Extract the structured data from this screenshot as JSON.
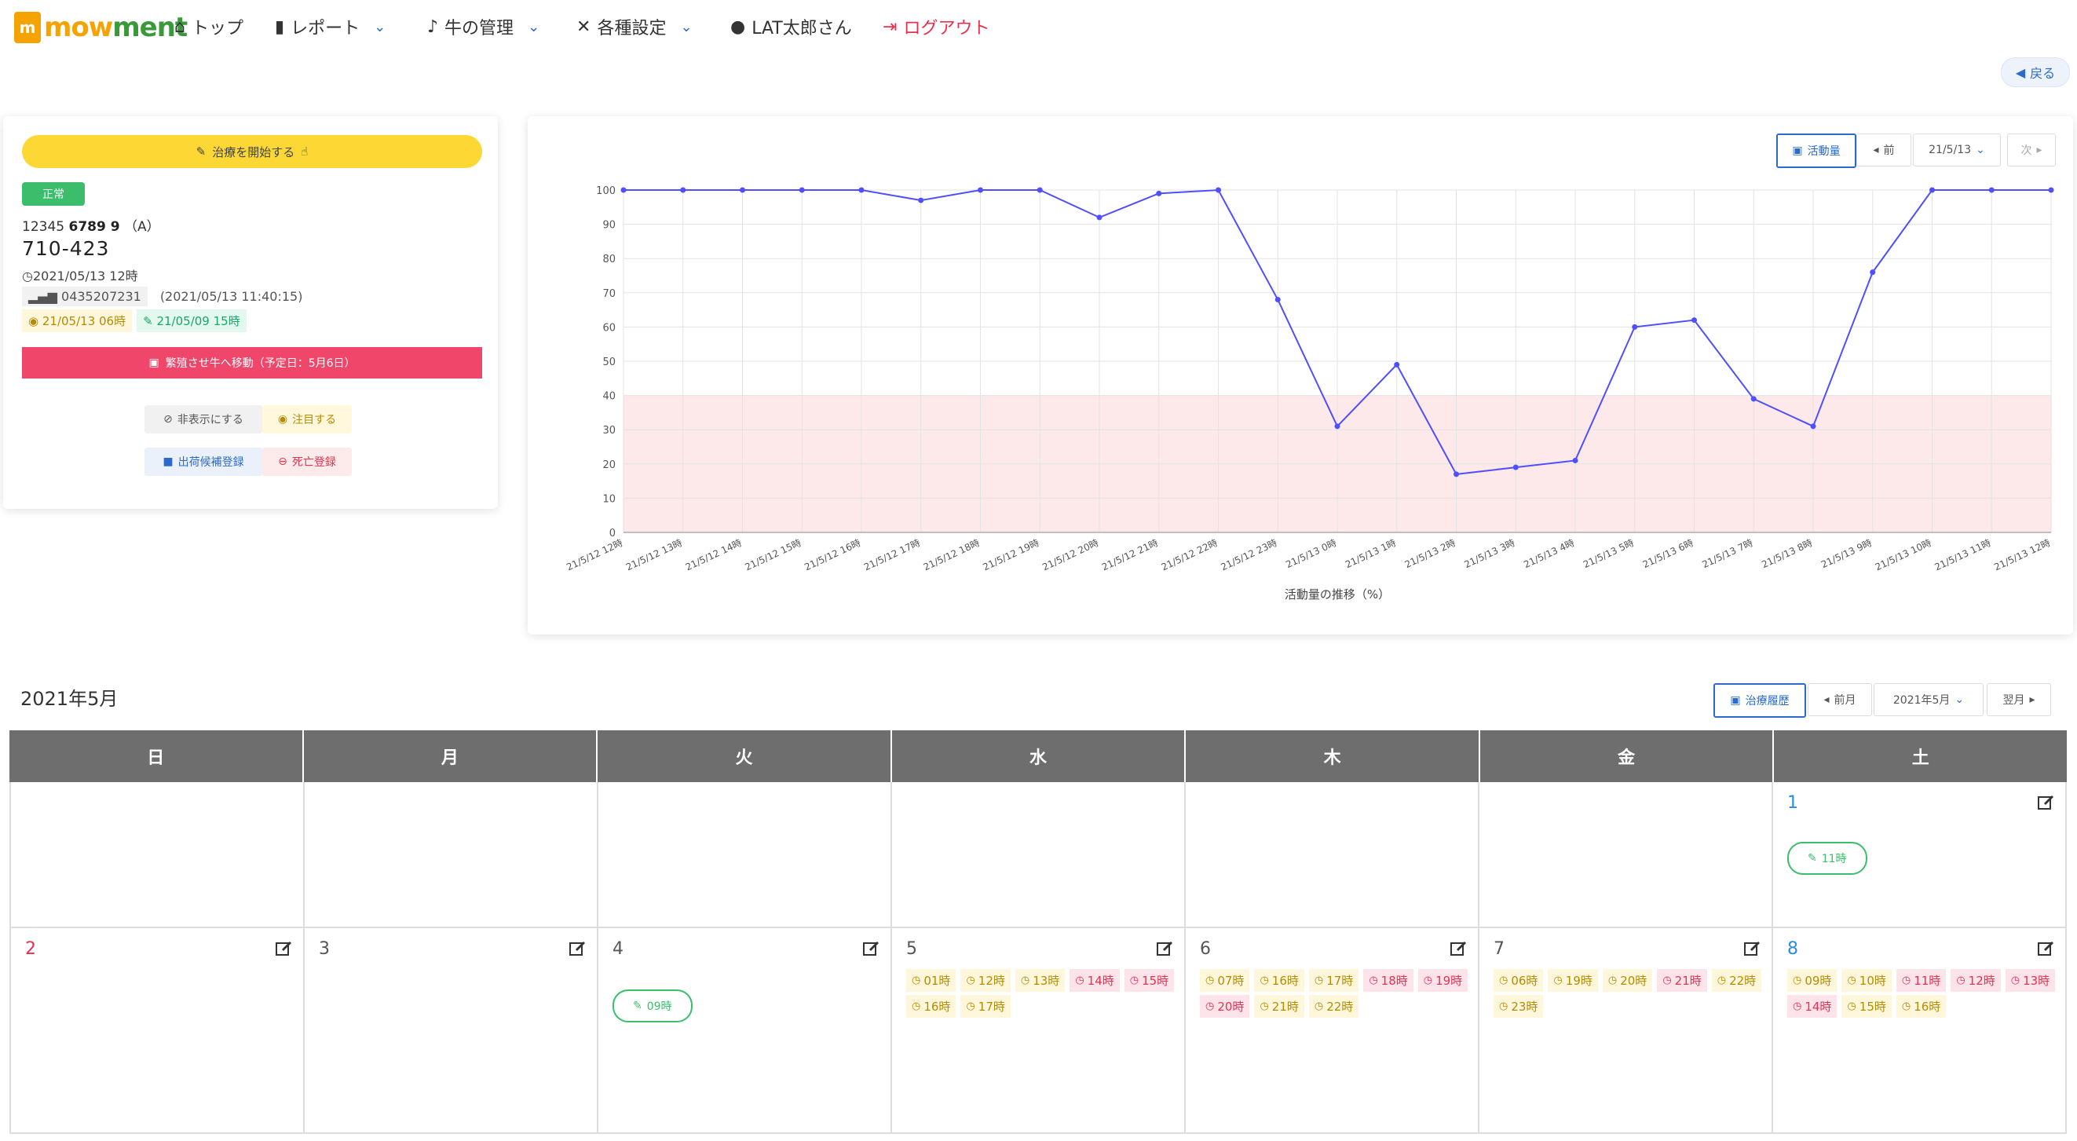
{
  "nav": {
    "logo": "mowment",
    "items": [
      "トップ",
      "レポート",
      "牛の管理",
      "各種設定",
      "LAT太郎さん",
      "ログアウト"
    ]
  },
  "back_btn": "戻る",
  "cow": {
    "start_btn": "治療を開始する",
    "status": "正常",
    "id_prefix": "12345",
    "id_bold": "6789 9",
    "id_suffix": "（A）",
    "number": "710-423",
    "date": "2021/05/13 12時",
    "sensor_id": "0435207231",
    "sensor_time": "(2021/05/13 11:40:15)",
    "tag1": "21/05/13 06時",
    "tag2": "21/05/09 15時",
    "move_btn": "繁殖させ牛へ移動（予定日：5月6日）",
    "btn_hide": "非表示にする",
    "btn_note": "注目する",
    "btn_ship": "出荷候補登録",
    "btn_dead": "死亡登録"
  },
  "chart_ctrls": {
    "activity": "活動量",
    "prev": "前",
    "date": "21/5/13",
    "next": "次"
  },
  "chart_data": {
    "type": "line",
    "xlabel": "活動量の推移（%）",
    "ylim": [
      0,
      100
    ],
    "yticks": [
      0,
      10,
      20,
      30,
      40,
      50,
      60,
      70,
      80,
      90,
      100
    ],
    "band": [
      0,
      40
    ],
    "color": "#4f4fff",
    "band_color": "#fde8ea",
    "categories": [
      "21/5/12 12時",
      "21/5/12 13時",
      "21/5/12 14時",
      "21/5/12 15時",
      "21/5/12 16時",
      "21/5/12 17時",
      "21/5/12 18時",
      "21/5/12 19時",
      "21/5/12 20時",
      "21/5/12 21時",
      "21/5/12 22時",
      "21/5/12 23時",
      "21/5/13 0時",
      "21/5/13 1時",
      "21/5/13 2時",
      "21/5/13 3時",
      "21/5/13 4時",
      "21/5/13 5時",
      "21/5/13 6時",
      "21/5/13 7時",
      "21/5/13 8時",
      "21/5/13 9時",
      "21/5/13 10時",
      "21/5/13 11時",
      "21/5/13 12時"
    ],
    "values": [
      100,
      100,
      100,
      100,
      100,
      97,
      100,
      100,
      92,
      99,
      100,
      68,
      31,
      49,
      17,
      19,
      21,
      60,
      62,
      39,
      31,
      76,
      100,
      100,
      100
    ]
  },
  "calendar": {
    "title": "2021年5月",
    "ctrls": {
      "history": "治療履歴",
      "prev": "前月",
      "month": "2021年5月",
      "next": "翌月"
    },
    "weekdays": [
      "日",
      "月",
      "火",
      "水",
      "木",
      "金",
      "土"
    ],
    "days": {
      "d1": "1",
      "d2": "2",
      "d3": "3",
      "d4": "4",
      "d5": "5",
      "d6": "6",
      "d7": "7",
      "d8": "8"
    },
    "pill1": "11時",
    "pill4": "09時",
    "d5_hours": [
      "01時",
      "12時",
      "13時",
      "14時",
      "15時",
      "16時",
      "17時"
    ],
    "d6_hours": [
      "07時",
      "16時",
      "17時",
      "18時",
      "19時",
      "20時",
      "21時",
      "22時"
    ],
    "d7_hours": [
      "06時",
      "19時",
      "20時",
      "21時",
      "22時",
      "23時"
    ],
    "d8_hours": [
      "09時",
      "10時",
      "11時",
      "12時",
      "13時",
      "14時",
      "15時",
      "16時"
    ]
  }
}
